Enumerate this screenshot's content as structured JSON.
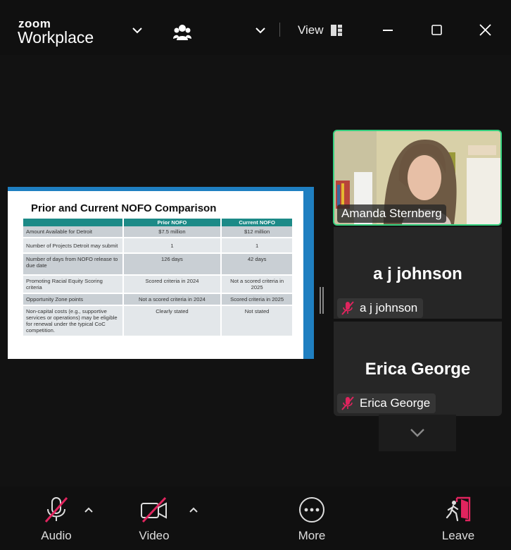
{
  "app": {
    "brand_top": "zoom",
    "brand_bottom": "Workplace",
    "view_label": "View"
  },
  "slide": {
    "title": "Prior and Current NOFO Comparison",
    "columns": [
      "",
      "Prior NOFO",
      "Current NOFO"
    ],
    "rows": [
      [
        "Amount Available for Detroit",
        "$7.5 million",
        "$12 million"
      ],
      [
        "Number of Projects Detroit may submit",
        "1",
        "1"
      ],
      [
        "Number of days from NOFO release to due date",
        "126 days",
        "42 days"
      ],
      [
        "Promoting Racial Equity Scoring criteria",
        "Scored criteria in 2024",
        "Not a scored criteria in 2025"
      ],
      [
        "Opportunity Zone points",
        "Not a scored criteria in 2024",
        "Scored criteria in 2025"
      ],
      [
        "Non-capital costs (e.g., supportive services or operations) may be eligible for renewal under the typical CoC competition.",
        "Clearly stated",
        "Not stated"
      ]
    ]
  },
  "participants": {
    "video": {
      "name": "Amanda Sternberg"
    },
    "tiles": [
      {
        "display_name": "a j johnson",
        "chip_name": "a j johnson",
        "muted": true
      },
      {
        "display_name": "Erica George",
        "chip_name": "Erica George",
        "muted": true
      }
    ]
  },
  "toolbar": {
    "audio_label": "Audio",
    "video_label": "Video",
    "more_label": "More",
    "leave_label": "Leave"
  },
  "colors": {
    "active_speaker": "#35d07f",
    "leave": "#e0245e",
    "muted": "#e0245e",
    "table_header": "#1c8a87",
    "slide_accent": "#1f7fc1"
  }
}
